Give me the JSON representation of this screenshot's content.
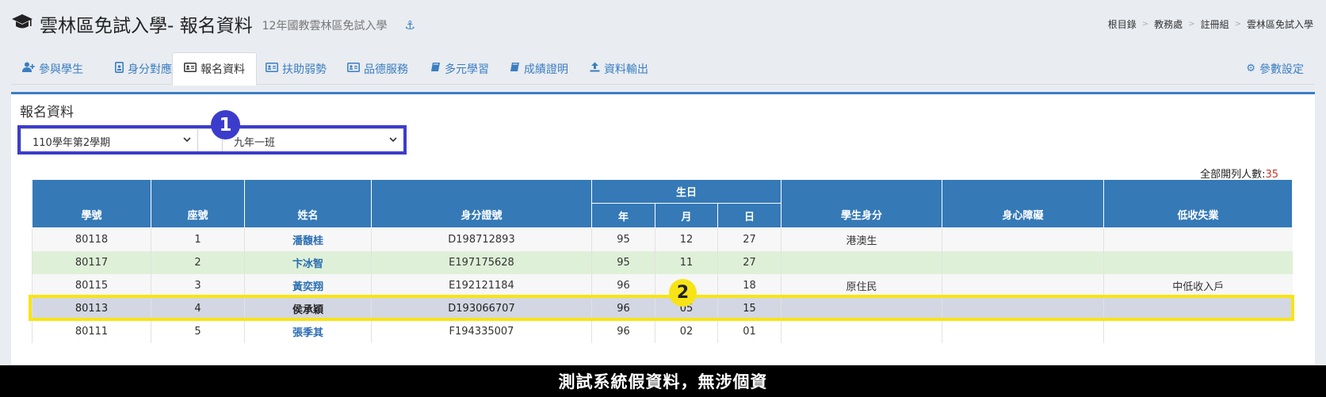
{
  "header": {
    "cap_icon": "graduation-cap-icon",
    "title": "雲林區免試入學- 報名資料",
    "subtitle": "12年國教雲林區免試入學",
    "anchor_icon": "anchor-icon",
    "anchor_glyph": "⚓"
  },
  "breadcrumb": [
    "根目錄",
    "教務處",
    "註冊組",
    "雲林區免試入學"
  ],
  "breadcrumb_sep": ">",
  "tabs": [
    {
      "label": "參與學生",
      "icon": "user-plus-icon",
      "glyph": "👥"
    },
    {
      "label": "身分對應",
      "icon": "id-badge-icon",
      "glyph": "▣"
    },
    {
      "label": "報名資料",
      "icon": "id-card-icon",
      "glyph": "▤"
    },
    {
      "label": "扶助弱勢",
      "icon": "id-card-icon",
      "glyph": "▤"
    },
    {
      "label": "品德服務",
      "icon": "id-card-icon",
      "glyph": "▤"
    },
    {
      "label": "多元學習",
      "icon": "book-icon",
      "glyph": "▱"
    },
    {
      "label": "成績證明",
      "icon": "book-icon",
      "glyph": "▱"
    },
    {
      "label": "資料輸出",
      "icon": "upload-icon",
      "glyph": "⤒"
    }
  ],
  "settings_tab": {
    "label": "參數設定",
    "icon": "gear-icon",
    "glyph": "⚙"
  },
  "panel": {
    "title": "報名資料"
  },
  "filters": {
    "semester": "110學年第2學期",
    "class": "九年一班",
    "chevron": "⌄"
  },
  "badges": {
    "one": "1",
    "two": "2"
  },
  "summary": {
    "label": "全部開列人數:",
    "count": "35"
  },
  "table": {
    "headers": {
      "student_no": "學號",
      "seat_no": "座號",
      "name": "姓名",
      "id_no": "身分證號",
      "birthday": "生日",
      "year": "年",
      "month": "月",
      "day": "日",
      "identity": "學生身分",
      "disability": "身心障礙",
      "low_income": "低收失業"
    },
    "rows": [
      {
        "student_no": "80118",
        "seat_no": "1",
        "name": "潘馥桂",
        "id_no": "D198712893",
        "year": "95",
        "month": "12",
        "day": "27",
        "identity": "港澳生",
        "disability": "",
        "low_income": ""
      },
      {
        "student_no": "80117",
        "seat_no": "2",
        "name": "卞冰智",
        "id_no": "E197175628",
        "year": "95",
        "month": "11",
        "day": "27",
        "identity": "",
        "disability": "",
        "low_income": ""
      },
      {
        "student_no": "80115",
        "seat_no": "3",
        "name": "黃奕翔",
        "id_no": "E192121184",
        "year": "96",
        "month": "",
        "day": "18",
        "identity": "原住民",
        "disability": "",
        "low_income": "中低收入戶"
      },
      {
        "student_no": "80113",
        "seat_no": "4",
        "name": "侯承穎",
        "id_no": "D193066707",
        "year": "96",
        "month": "05",
        "day": "15",
        "identity": "",
        "disability": "",
        "low_income": ""
      },
      {
        "student_no": "80111",
        "seat_no": "5",
        "name": "張季其",
        "id_no": "F194335007",
        "year": "96",
        "month": "02",
        "day": "01",
        "identity": "",
        "disability": "",
        "low_income": ""
      }
    ]
  },
  "footer": {
    "text": "測試系統假資料，無涉個資"
  },
  "colors": {
    "accent": "#3a7ec1",
    "table_header": "#3579b7",
    "highlight_blue": "#3c3ccc",
    "highlight_yellow": "#f7e416",
    "selected_row": "#d3d7e3",
    "success_row": "#dff0d8"
  }
}
